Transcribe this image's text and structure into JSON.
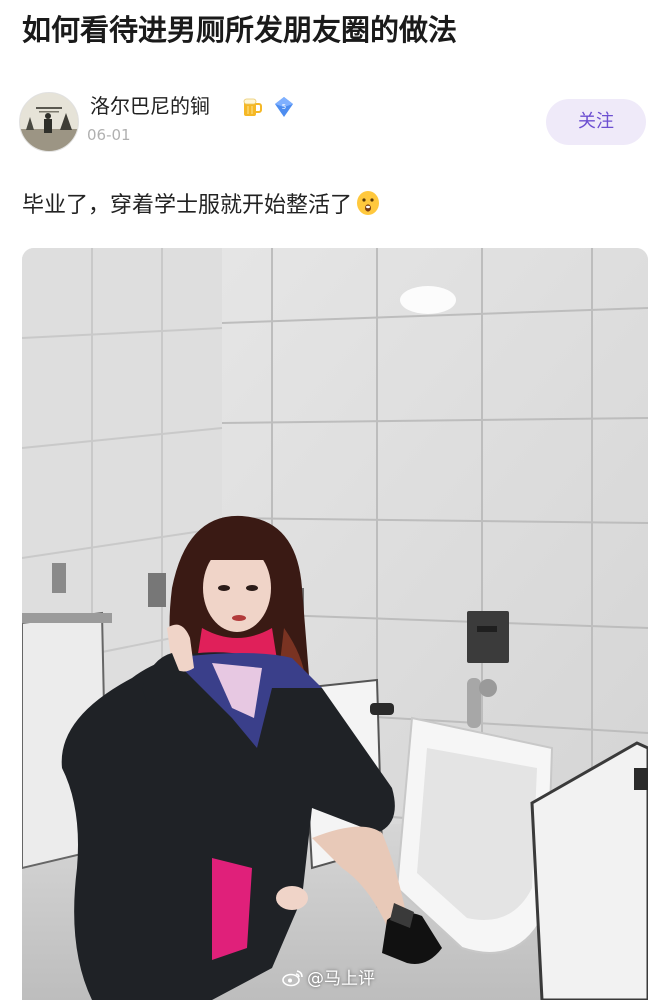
{
  "post": {
    "title": "如何看待进男厕所发朋友圈的做法",
    "author": {
      "name": "洛尔巴尼的锏",
      "date": "06-01",
      "badges": [
        "beer-mug-icon",
        "vip-diamond-icon"
      ]
    },
    "follow_label": "关注",
    "text": "毕业了，穿着学士服就开始整活了",
    "text_emoji": "grimace-emoji-icon",
    "watermark": "@马上评"
  },
  "colors": {
    "follow_bg": "#efeaf9",
    "follow_text": "#6c4fd1",
    "date_text": "#b0b0b0"
  }
}
